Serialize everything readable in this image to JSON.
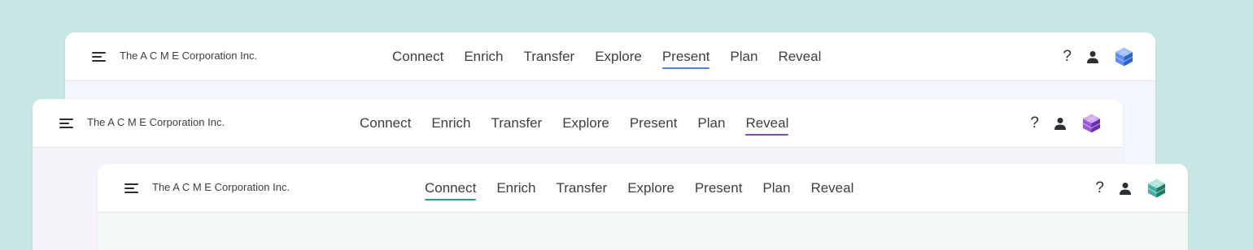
{
  "windows": [
    {
      "company": "The A C M E Corporation Inc.",
      "nav": [
        "Connect",
        "Enrich",
        "Transfer",
        "Explore",
        "Present",
        "Plan",
        "Reveal"
      ],
      "active": "Present",
      "accent": "#4f7fe0",
      "logo_colors": [
        "#2f63c9",
        "#5b8ef0",
        "#9cc0ff"
      ],
      "icons": [
        "menu-icon",
        "help-icon",
        "user-icon",
        "logo-cube-icon"
      ],
      "help": "?"
    },
    {
      "company": "The A C M E Corporation Inc.",
      "nav": [
        "Connect",
        "Enrich",
        "Transfer",
        "Explore",
        "Present",
        "Plan",
        "Reveal"
      ],
      "active": "Reveal",
      "accent": "#8a45c4",
      "logo_colors": [
        "#6a2fb0",
        "#9b5bd8",
        "#d1a8f3"
      ],
      "icons": [
        "menu-icon",
        "help-icon",
        "user-icon",
        "logo-cube-icon"
      ],
      "help": "?"
    },
    {
      "company": "The A C M E Corporation Inc.",
      "nav": [
        "Connect",
        "Enrich",
        "Transfer",
        "Explore",
        "Present",
        "Plan",
        "Reveal"
      ],
      "active": "Connect",
      "accent": "#2a9c88",
      "logo_colors": [
        "#1f7a6c",
        "#3fb3a0",
        "#a8e4d9"
      ],
      "icons": [
        "menu-icon",
        "help-icon",
        "user-icon",
        "logo-cube-icon"
      ],
      "help": "?"
    }
  ]
}
